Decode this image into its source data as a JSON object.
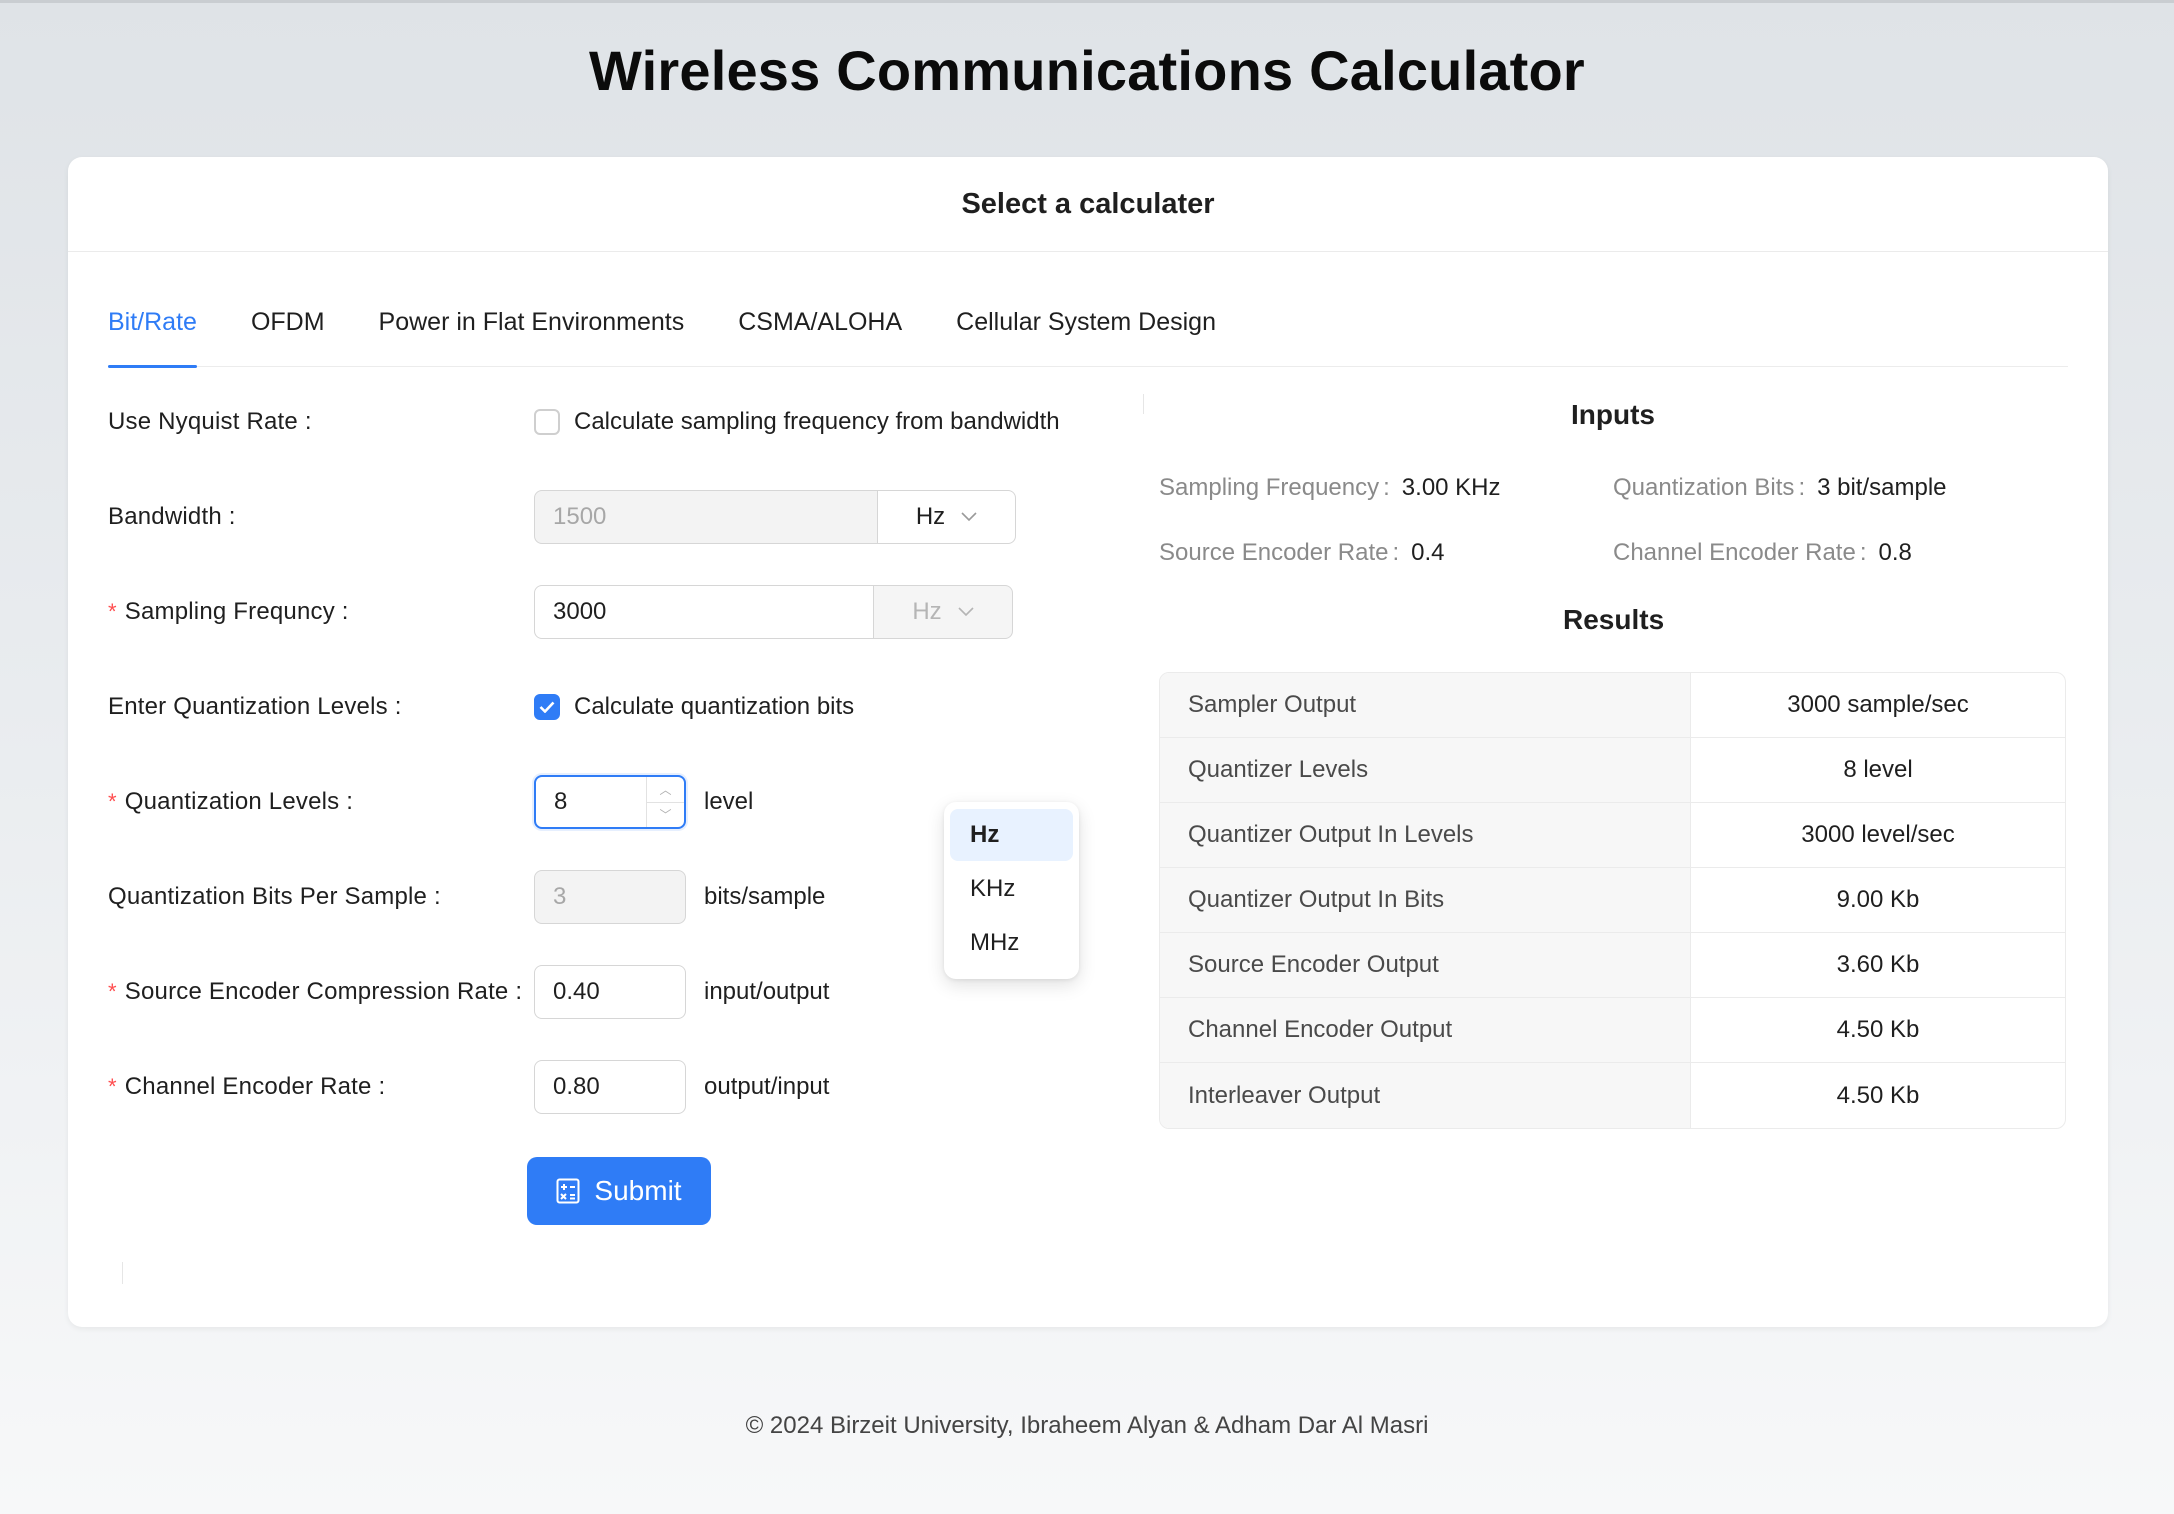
{
  "app": {
    "title": "Wireless Communications Calculator"
  },
  "card": {
    "header": "Select a calculater"
  },
  "tabs": [
    {
      "label": "Bit/Rate",
      "active": true
    },
    {
      "label": "OFDM",
      "active": false
    },
    {
      "label": "Power in Flat Environments",
      "active": false
    },
    {
      "label": "CSMA/ALOHA",
      "active": false
    },
    {
      "label": "Cellular System Design",
      "active": false
    }
  ],
  "form": {
    "nyquist": {
      "label": "Use Nyquist Rate",
      "checkbox_text": "Calculate sampling frequency from bandwidth",
      "checked": false
    },
    "bandwidth": {
      "label": "Bandwidth",
      "value": "1500",
      "unit": "Hz",
      "disabled": true
    },
    "sampling": {
      "label": "Sampling Frequncy",
      "value": "3000",
      "unit": "Hz",
      "required": true
    },
    "enter_levels": {
      "label": "Enter Quantization Levels",
      "checkbox_text": "Calculate quantization bits",
      "checked": true
    },
    "levels": {
      "label": "Quantization Levels",
      "value": "8",
      "suffix": "level",
      "required": true
    },
    "bits": {
      "label": "Quantization Bits Per Sample",
      "value": "3",
      "suffix": "bits/sample",
      "disabled": true
    },
    "source_rate": {
      "label": "Source Encoder Compression Rate",
      "value": "0.40",
      "suffix": "input/output",
      "required": true
    },
    "channel_rate": {
      "label": "Channel Encoder Rate",
      "value": "0.80",
      "suffix": "output/input",
      "required": true
    },
    "submit_label": "Submit"
  },
  "dropdown": {
    "options": [
      "Hz",
      "KHz",
      "MHz"
    ],
    "selected": "Hz"
  },
  "inputs": {
    "title": "Inputs",
    "items": [
      {
        "key": "Sampling Frequency",
        "value": "3.00 KHz"
      },
      {
        "key": "Quantization Bits",
        "value": "3 bit/sample"
      },
      {
        "key": "Source Encoder Rate",
        "value": "0.4"
      },
      {
        "key": "Channel Encoder Rate",
        "value": "0.8"
      }
    ]
  },
  "results": {
    "title": "Results",
    "rows": [
      {
        "key": "Sampler Output",
        "value": "3000 sample/sec"
      },
      {
        "key": "Quantizer Levels",
        "value": "8 level"
      },
      {
        "key": "Quantizer Output In Levels",
        "value": "3000 level/sec"
      },
      {
        "key": "Quantizer Output In Bits",
        "value": "9.00 Kb"
      },
      {
        "key": "Source Encoder Output",
        "value": "3.60 Kb"
      },
      {
        "key": "Channel Encoder Output",
        "value": "4.50 Kb"
      },
      {
        "key": "Interleaver Output",
        "value": "4.50 Kb"
      }
    ]
  },
  "footer": {
    "text": "© 2024 Birzeit University, Ibraheem Alyan & Adham Dar Al Masri"
  },
  "colors": {
    "accent": "#2f7cf6",
    "required": "#ff4d4f"
  }
}
